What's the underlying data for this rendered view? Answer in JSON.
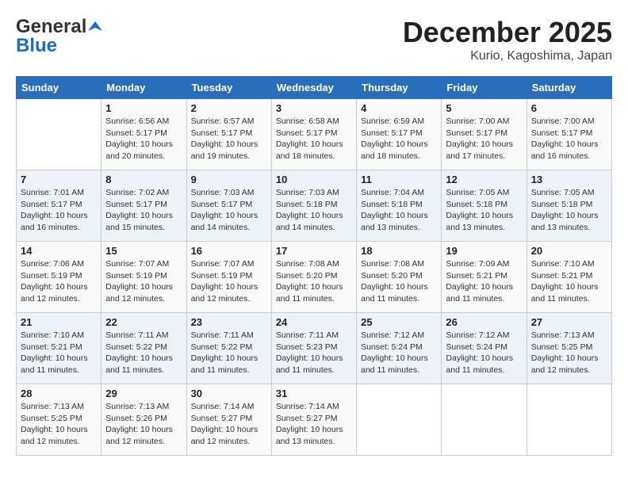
{
  "header": {
    "logo_line1": "General",
    "logo_line2": "Blue",
    "month_title": "December 2025",
    "subtitle": "Kurio, Kagoshima, Japan"
  },
  "weekdays": [
    "Sunday",
    "Monday",
    "Tuesday",
    "Wednesday",
    "Thursday",
    "Friday",
    "Saturday"
  ],
  "weeks": [
    [
      {
        "day": "",
        "info": ""
      },
      {
        "day": "1",
        "info": "Sunrise: 6:56 AM\nSunset: 5:17 PM\nDaylight: 10 hours\nand 20 minutes."
      },
      {
        "day": "2",
        "info": "Sunrise: 6:57 AM\nSunset: 5:17 PM\nDaylight: 10 hours\nand 19 minutes."
      },
      {
        "day": "3",
        "info": "Sunrise: 6:58 AM\nSunset: 5:17 PM\nDaylight: 10 hours\nand 18 minutes."
      },
      {
        "day": "4",
        "info": "Sunrise: 6:59 AM\nSunset: 5:17 PM\nDaylight: 10 hours\nand 18 minutes."
      },
      {
        "day": "5",
        "info": "Sunrise: 7:00 AM\nSunset: 5:17 PM\nDaylight: 10 hours\nand 17 minutes."
      },
      {
        "day": "6",
        "info": "Sunrise: 7:00 AM\nSunset: 5:17 PM\nDaylight: 10 hours\nand 16 minutes."
      }
    ],
    [
      {
        "day": "7",
        "info": "Sunrise: 7:01 AM\nSunset: 5:17 PM\nDaylight: 10 hours\nand 16 minutes."
      },
      {
        "day": "8",
        "info": "Sunrise: 7:02 AM\nSunset: 5:17 PM\nDaylight: 10 hours\nand 15 minutes."
      },
      {
        "day": "9",
        "info": "Sunrise: 7:03 AM\nSunset: 5:17 PM\nDaylight: 10 hours\nand 14 minutes."
      },
      {
        "day": "10",
        "info": "Sunrise: 7:03 AM\nSunset: 5:18 PM\nDaylight: 10 hours\nand 14 minutes."
      },
      {
        "day": "11",
        "info": "Sunrise: 7:04 AM\nSunset: 5:18 PM\nDaylight: 10 hours\nand 13 minutes."
      },
      {
        "day": "12",
        "info": "Sunrise: 7:05 AM\nSunset: 5:18 PM\nDaylight: 10 hours\nand 13 minutes."
      },
      {
        "day": "13",
        "info": "Sunrise: 7:05 AM\nSunset: 5:18 PM\nDaylight: 10 hours\nand 13 minutes."
      }
    ],
    [
      {
        "day": "14",
        "info": "Sunrise: 7:06 AM\nSunset: 5:19 PM\nDaylight: 10 hours\nand 12 minutes."
      },
      {
        "day": "15",
        "info": "Sunrise: 7:07 AM\nSunset: 5:19 PM\nDaylight: 10 hours\nand 12 minutes."
      },
      {
        "day": "16",
        "info": "Sunrise: 7:07 AM\nSunset: 5:19 PM\nDaylight: 10 hours\nand 12 minutes."
      },
      {
        "day": "17",
        "info": "Sunrise: 7:08 AM\nSunset: 5:20 PM\nDaylight: 10 hours\nand 11 minutes."
      },
      {
        "day": "18",
        "info": "Sunrise: 7:08 AM\nSunset: 5:20 PM\nDaylight: 10 hours\nand 11 minutes."
      },
      {
        "day": "19",
        "info": "Sunrise: 7:09 AM\nSunset: 5:21 PM\nDaylight: 10 hours\nand 11 minutes."
      },
      {
        "day": "20",
        "info": "Sunrise: 7:10 AM\nSunset: 5:21 PM\nDaylight: 10 hours\nand 11 minutes."
      }
    ],
    [
      {
        "day": "21",
        "info": "Sunrise: 7:10 AM\nSunset: 5:21 PM\nDaylight: 10 hours\nand 11 minutes."
      },
      {
        "day": "22",
        "info": "Sunrise: 7:11 AM\nSunset: 5:22 PM\nDaylight: 10 hours\nand 11 minutes."
      },
      {
        "day": "23",
        "info": "Sunrise: 7:11 AM\nSunset: 5:22 PM\nDaylight: 10 hours\nand 11 minutes."
      },
      {
        "day": "24",
        "info": "Sunrise: 7:11 AM\nSunset: 5:23 PM\nDaylight: 10 hours\nand 11 minutes."
      },
      {
        "day": "25",
        "info": "Sunrise: 7:12 AM\nSunset: 5:24 PM\nDaylight: 10 hours\nand 11 minutes."
      },
      {
        "day": "26",
        "info": "Sunrise: 7:12 AM\nSunset: 5:24 PM\nDaylight: 10 hours\nand 11 minutes."
      },
      {
        "day": "27",
        "info": "Sunrise: 7:13 AM\nSunset: 5:25 PM\nDaylight: 10 hours\nand 12 minutes."
      }
    ],
    [
      {
        "day": "28",
        "info": "Sunrise: 7:13 AM\nSunset: 5:25 PM\nDaylight: 10 hours\nand 12 minutes."
      },
      {
        "day": "29",
        "info": "Sunrise: 7:13 AM\nSunset: 5:26 PM\nDaylight: 10 hours\nand 12 minutes."
      },
      {
        "day": "30",
        "info": "Sunrise: 7:14 AM\nSunset: 5:27 PM\nDaylight: 10 hours\nand 12 minutes."
      },
      {
        "day": "31",
        "info": "Sunrise: 7:14 AM\nSunset: 5:27 PM\nDaylight: 10 hours\nand 13 minutes."
      },
      {
        "day": "",
        "info": ""
      },
      {
        "day": "",
        "info": ""
      },
      {
        "day": "",
        "info": ""
      }
    ]
  ]
}
